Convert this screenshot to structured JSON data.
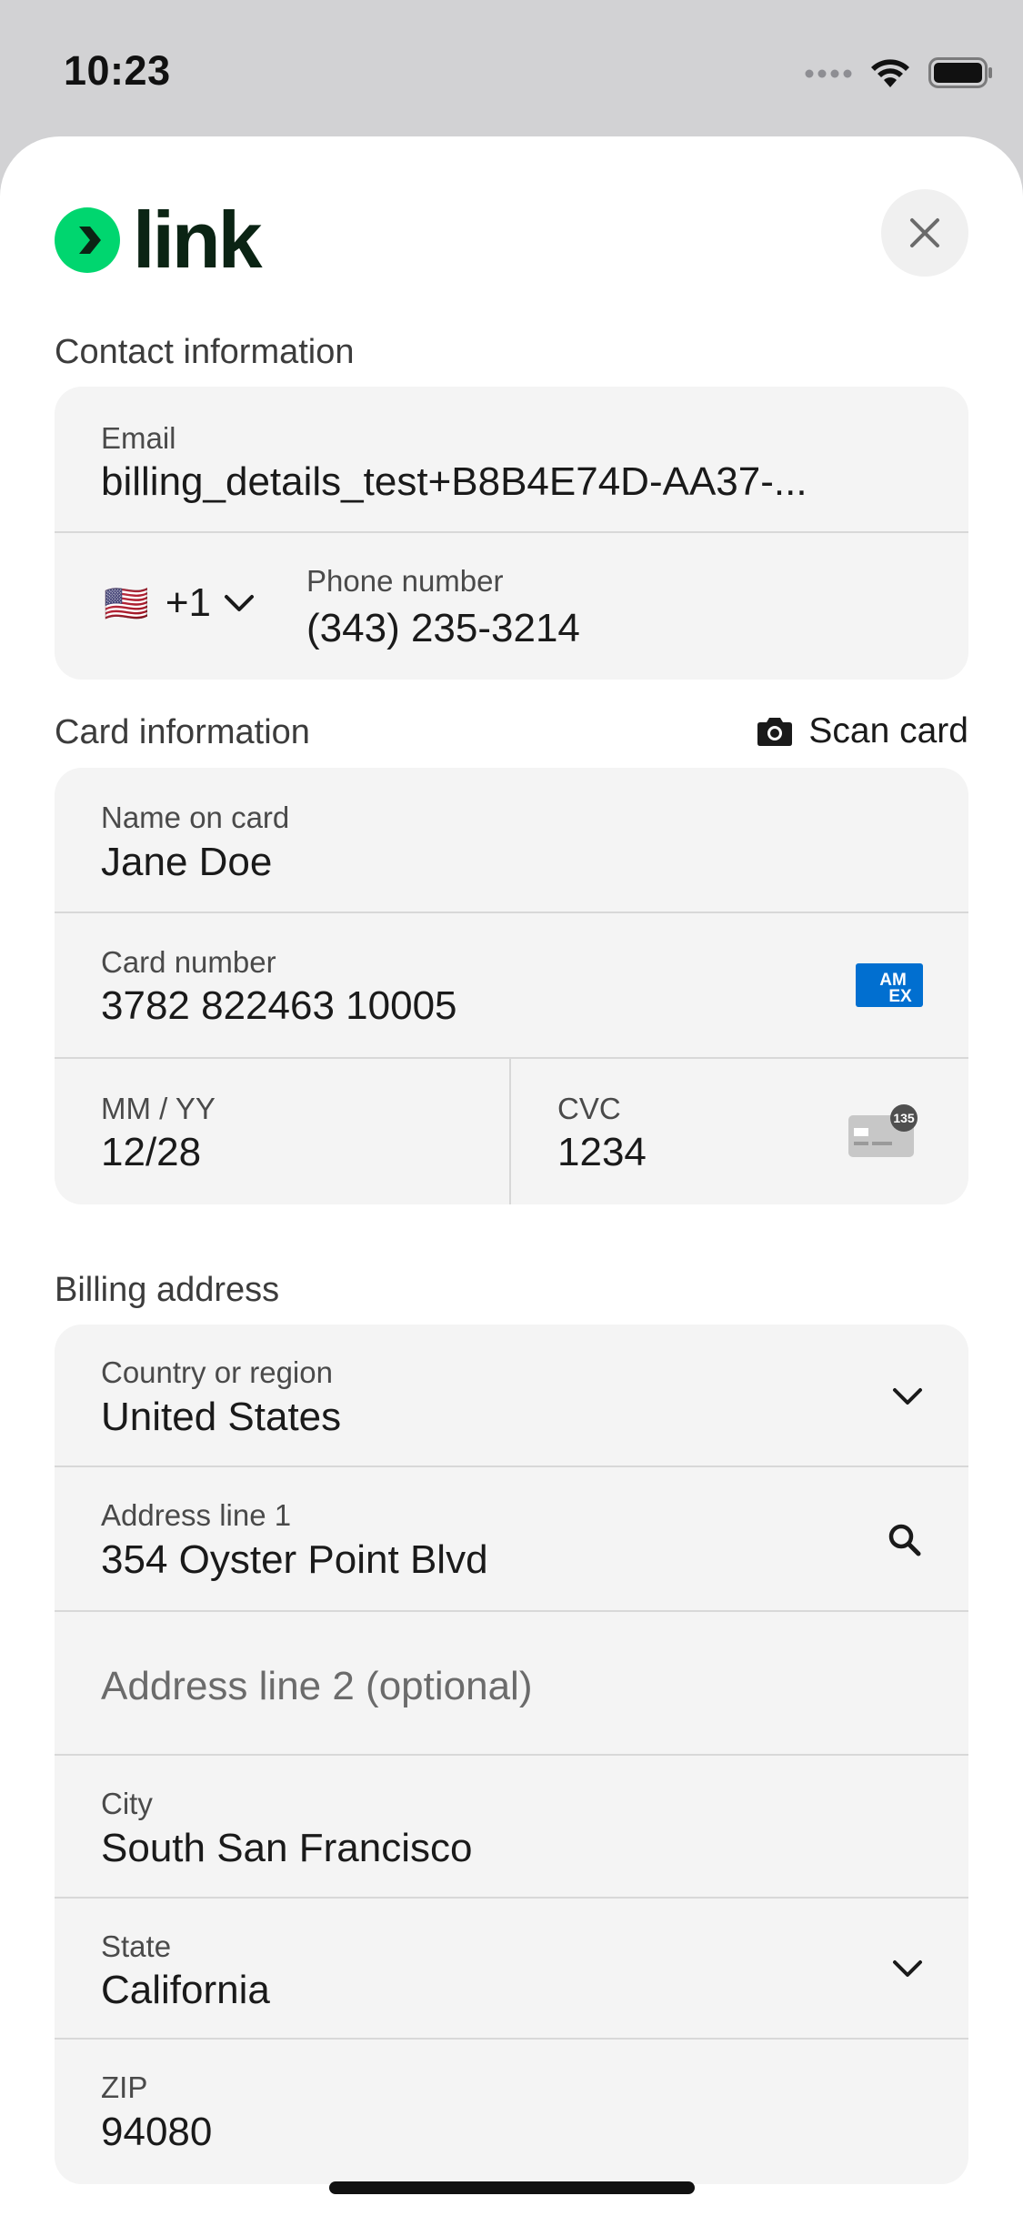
{
  "status_bar": {
    "time": "10:23",
    "icons": [
      "signal-icon",
      "wifi-icon",
      "battery-icon"
    ]
  },
  "header": {
    "logo_text": "link",
    "logo_color": "#00d66f",
    "close_icon": "close-icon"
  },
  "contact": {
    "section_label": "Contact information",
    "email_label": "Email",
    "email_value": "billing_details_test+B8B4E74D-AA37-...",
    "country_flag": "🇺🇸",
    "country_code": "+1",
    "phone_label": "Phone number",
    "phone_value": "(343) 235-3214"
  },
  "card": {
    "section_label": "Card information",
    "scan_label": "Scan card",
    "name_label": "Name on card",
    "name_value": "Jane Doe",
    "number_label": "Card number",
    "number_value": "3782 822463 10005",
    "card_brand_icon": "amex-icon",
    "amex_text_1": "AM",
    "amex_text_2": "EX",
    "expiry_label": "MM / YY",
    "expiry_value": "12/28",
    "cvc_label": "CVC",
    "cvc_value": "1234",
    "cvc_badge": "135"
  },
  "billing": {
    "section_label": "Billing address",
    "country_label": "Country or region",
    "country_value": "United States",
    "line1_label": "Address line 1",
    "line1_value": "354 Oyster Point Blvd",
    "line2_placeholder": "Address line 2 (optional)",
    "city_label": "City",
    "city_value": "South San Francisco",
    "state_label": "State",
    "state_value": "California",
    "zip_label": "ZIP",
    "zip_value": "94080"
  },
  "colors": {
    "brand_green": "#00d66f",
    "amex_blue": "#016fd0",
    "field_bg": "#f4f4f4"
  }
}
